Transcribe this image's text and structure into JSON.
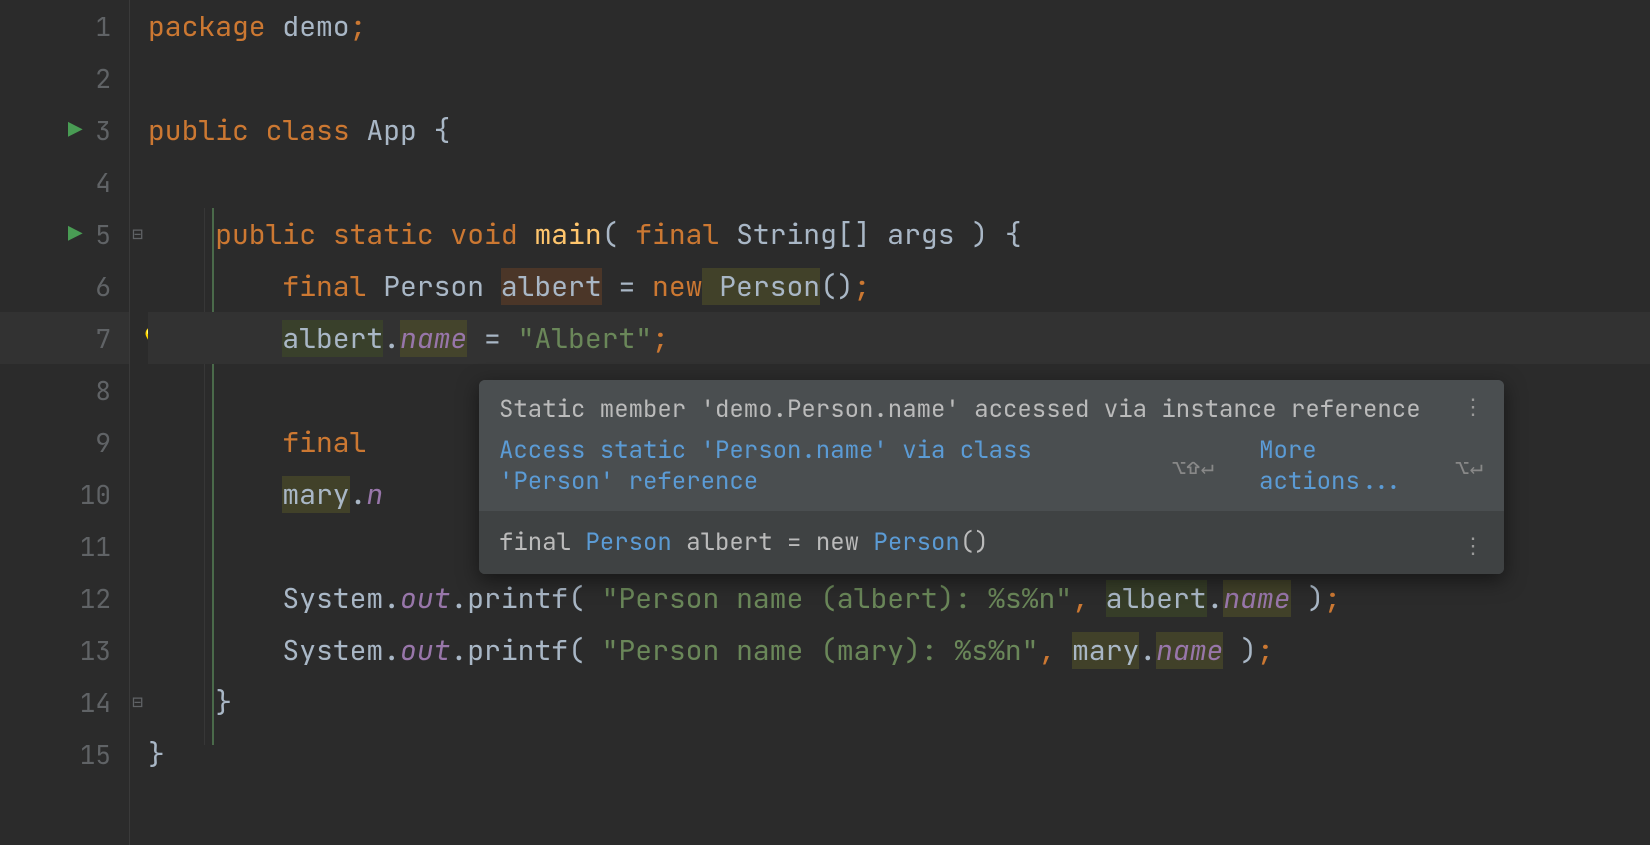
{
  "gutter": {
    "lines": [
      "1",
      "2",
      "3",
      "4",
      "5",
      "6",
      "7",
      "8",
      "9",
      "10",
      "11",
      "12",
      "13",
      "14",
      "15"
    ],
    "run_lines": [
      3,
      5
    ],
    "bulb_line": 7,
    "fold_open_line": 5,
    "fold_close_line": 14,
    "active_line": 7
  },
  "code": {
    "l1": {
      "kw_package": "package",
      "pkg": " demo",
      "semi": ";"
    },
    "l3": {
      "kw_public": "public",
      "kw_class": " class",
      "cls": " App ",
      "brace": "{"
    },
    "l5": {
      "indent": "    ",
      "kw_public": "public",
      "kw_static": " static",
      "kw_void": " void",
      "mth": " main",
      "open": "( ",
      "kw_final": "final",
      "type": " String[] ",
      "arg": "args ",
      "close": ") ",
      "brace": "{"
    },
    "l6": {
      "indent": "        ",
      "kw_final": "final",
      "type": " Person ",
      "var": "albert",
      "eq": " = ",
      "kw_new": "new",
      "ctor": " Person",
      "parens": "()",
      "semi": ";"
    },
    "l7": {
      "indent": "        ",
      "obj": "albert",
      "dot": ".",
      "field": "name",
      "eq": " = ",
      "str": "\"Albert\"",
      "semi": ";"
    },
    "l9": {
      "indent": "        ",
      "kw_final": "final "
    },
    "l10": {
      "indent": "        ",
      "obj": "mary",
      "dot": ".",
      "field": "n"
    },
    "l12": {
      "indent": "        ",
      "sys": "System",
      "dot1": ".",
      "out": "out",
      "dot2": ".",
      "printf": "printf",
      "open": "( ",
      "str": "\"Person name (albert): %s%n\"",
      "comma": ",",
      "sp": " ",
      "obj": "albert",
      "dot3": ".",
      "field": "name",
      "close": " )",
      "semi": ";"
    },
    "l13": {
      "indent": "        ",
      "sys": "System",
      "dot1": ".",
      "out": "out",
      "dot2": ".",
      "printf": "printf",
      "open": "( ",
      "str": "\"Person name (mary): %s%n\"",
      "comma": ",",
      "sp": " ",
      "obj": "mary",
      "dot3": ".",
      "field": "name",
      "close": " )",
      "semi": ";"
    },
    "l14": {
      "indent": "    ",
      "brace": "}"
    },
    "l15": {
      "brace": "}"
    }
  },
  "popup": {
    "message": "Static member 'demo.Person.name' accessed via instance reference",
    "fix_label": "Access static 'Person.name' via class 'Person' reference",
    "fix_shortcut": "⌥⇧↵",
    "more_label": "More actions...",
    "more_shortcut": "⌥↵",
    "doc": {
      "kw_final": "final ",
      "type1": "Person",
      "var": " albert = ",
      "kw_new": "new ",
      "type2": "Person",
      "parens": "()"
    },
    "dots": "⋮"
  }
}
